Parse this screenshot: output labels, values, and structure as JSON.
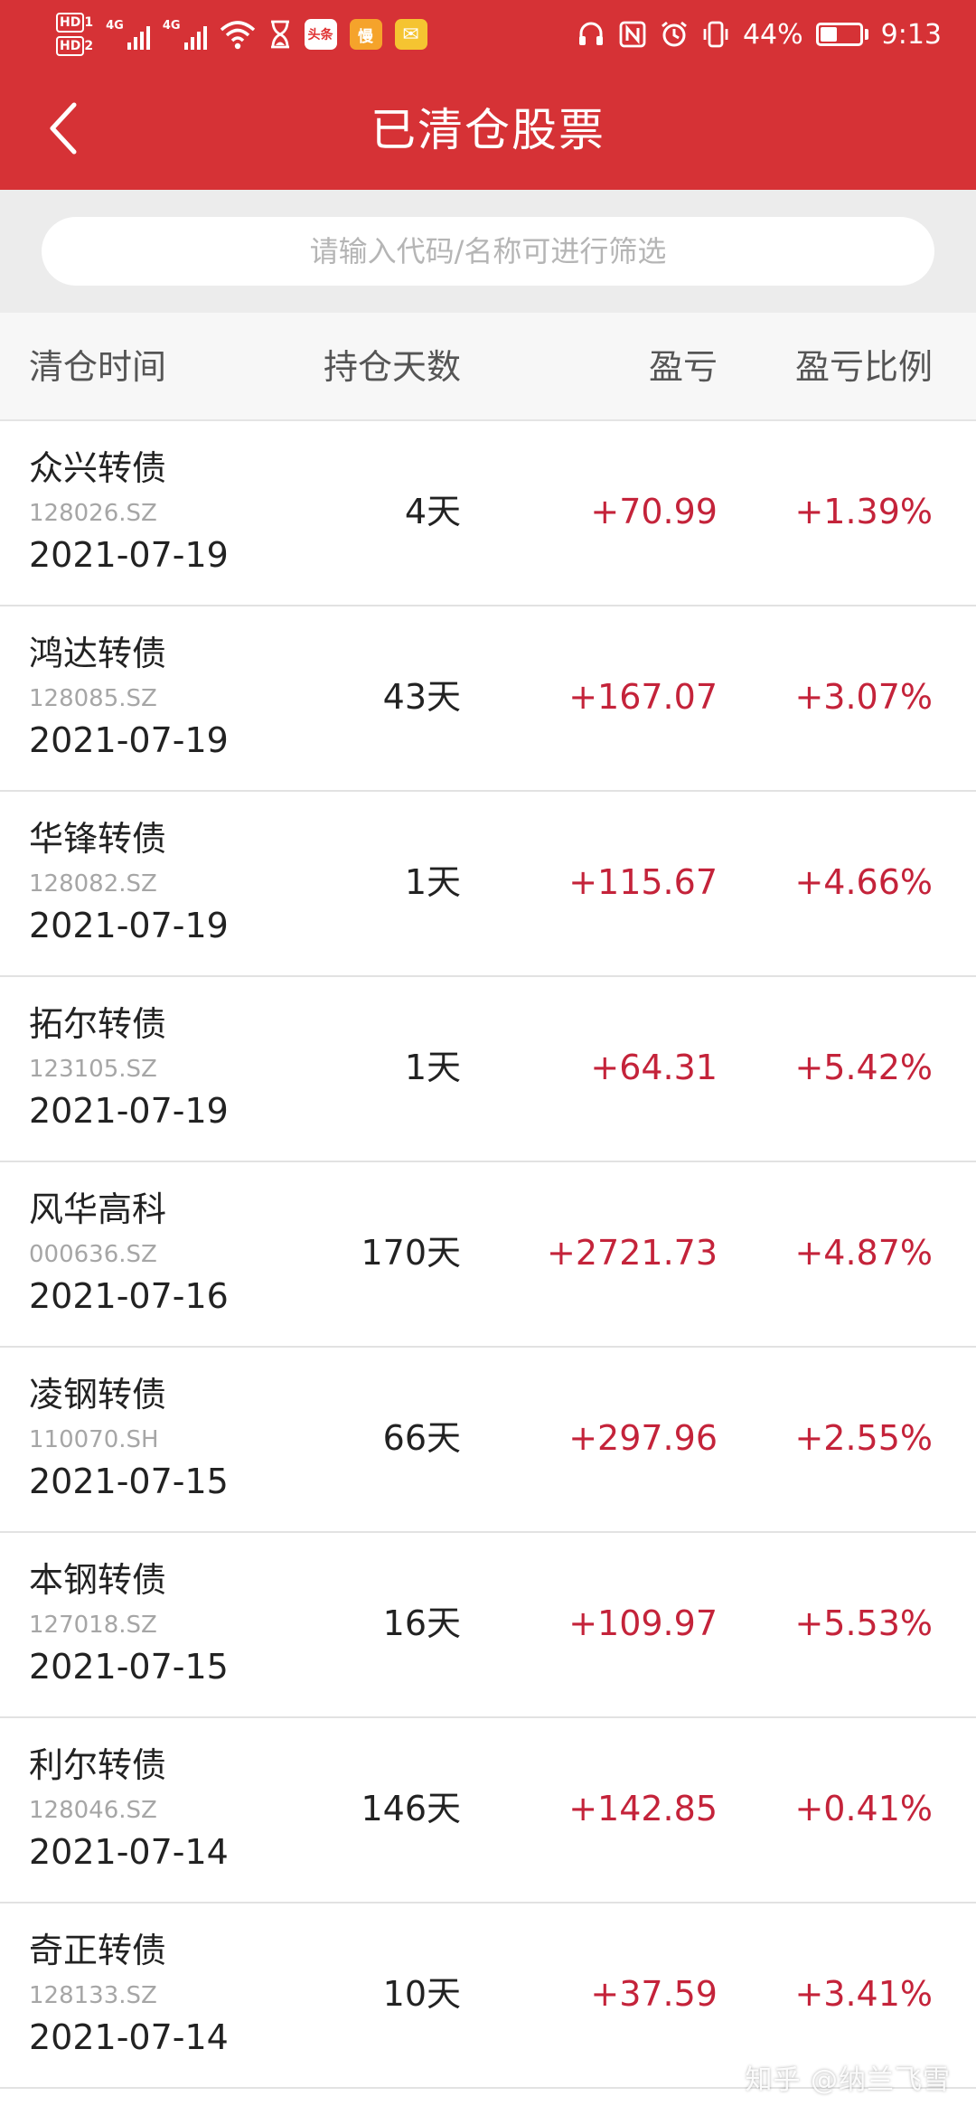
{
  "status_bar": {
    "hd_top": "HD",
    "hd_top_sub": "1",
    "hd_bottom": "HD",
    "hd_bottom_sub": "2",
    "net1": "4G",
    "net2": "4G",
    "app1": "头条",
    "app2": "慢",
    "battery_percent": "44%",
    "time": "9:13",
    "battery_level": 0.44
  },
  "nav": {
    "title": "已清仓股票"
  },
  "search": {
    "placeholder": "请输入代码/名称可进行筛选"
  },
  "columns": {
    "time": "清仓时间",
    "days": "持仓天数",
    "pnl": "盈亏",
    "ratio": "盈亏比例"
  },
  "rows": [
    {
      "name": "众兴转债",
      "code": "128026.SZ",
      "date": "2021-07-19",
      "days": "4天",
      "pnl": "+70.99",
      "ratio": "+1.39%"
    },
    {
      "name": "鸿达转债",
      "code": "128085.SZ",
      "date": "2021-07-19",
      "days": "43天",
      "pnl": "+167.07",
      "ratio": "+3.07%"
    },
    {
      "name": "华锋转债",
      "code": "128082.SZ",
      "date": "2021-07-19",
      "days": "1天",
      "pnl": "+115.67",
      "ratio": "+4.66%"
    },
    {
      "name": "拓尔转债",
      "code": "123105.SZ",
      "date": "2021-07-19",
      "days": "1天",
      "pnl": "+64.31",
      "ratio": "+5.42%"
    },
    {
      "name": "风华高科",
      "code": "000636.SZ",
      "date": "2021-07-16",
      "days": "170天",
      "pnl": "+2721.73",
      "ratio": "+4.87%"
    },
    {
      "name": "凌钢转债",
      "code": "110070.SH",
      "date": "2021-07-15",
      "days": "66天",
      "pnl": "+297.96",
      "ratio": "+2.55%"
    },
    {
      "name": "本钢转债",
      "code": "127018.SZ",
      "date": "2021-07-15",
      "days": "16天",
      "pnl": "+109.97",
      "ratio": "+5.53%"
    },
    {
      "name": "利尔转债",
      "code": "128046.SZ",
      "date": "2021-07-14",
      "days": "146天",
      "pnl": "+142.85",
      "ratio": "+0.41%"
    },
    {
      "name": "奇正转债",
      "code": "128133.SZ",
      "date": "2021-07-14",
      "days": "10天",
      "pnl": "+37.59",
      "ratio": "+3.41%"
    }
  ],
  "watermark": "知乎 @纳兰飞雪",
  "colors": {
    "header": "#d63236",
    "profit": "#c4233a"
  }
}
